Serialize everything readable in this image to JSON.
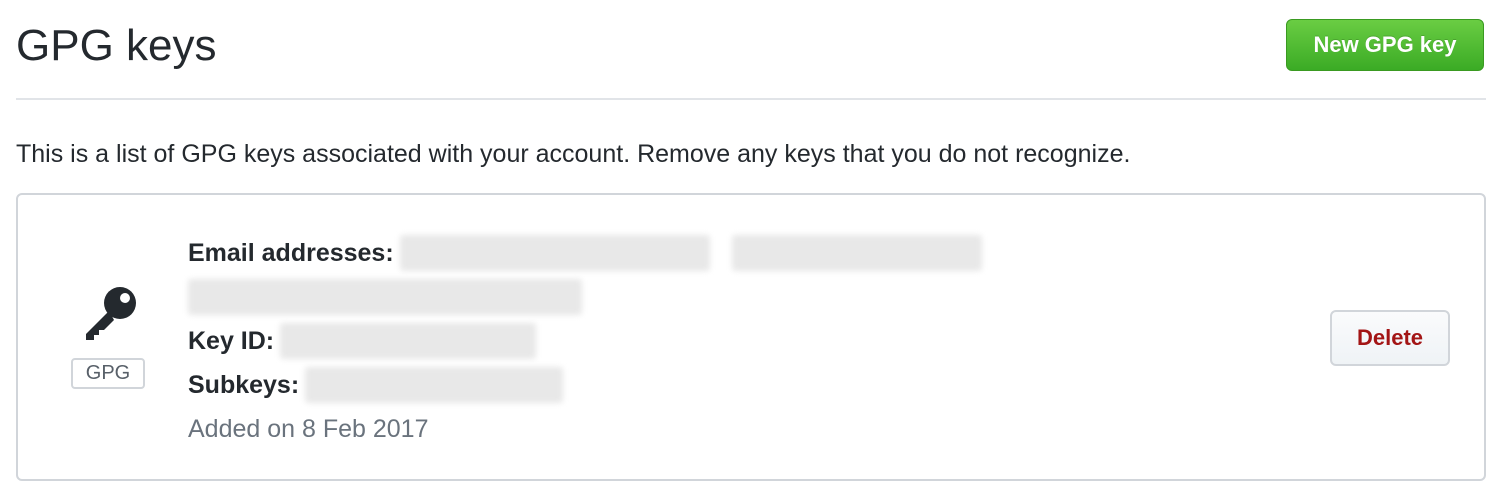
{
  "header": {
    "title": "GPG keys",
    "new_key_button_label": "New GPG key"
  },
  "intro": {
    "text": "This is a list of GPG keys associated with your account. Remove any keys that you do not recognize."
  },
  "key": {
    "type_badge": "GPG",
    "email_label": "Email addresses:",
    "key_id_label": "Key ID:",
    "subkeys_label": "Subkeys:",
    "added": "Added on 8 Feb 2017",
    "delete_label": "Delete",
    "icon": "key-icon"
  },
  "colors": {
    "primary_green": "#3bab25",
    "danger_red": "#a31515",
    "border": "#d1d5da",
    "muted_text": "#6a737d"
  }
}
